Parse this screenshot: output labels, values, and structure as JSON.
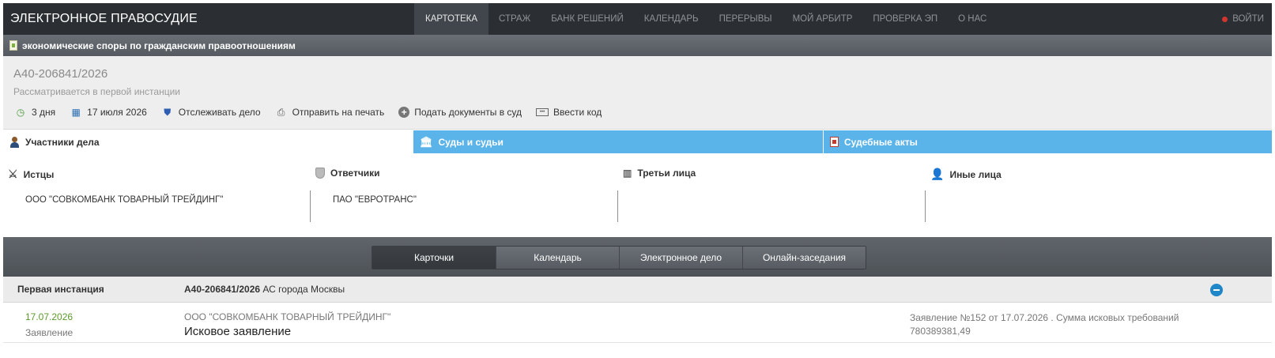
{
  "header": {
    "brand": "ЭЛЕКТРОННОЕ ПРАВОСУДИЕ",
    "nav": [
      "КАРТОТЕКА",
      "СТРАЖ",
      "БАНК РЕШЕНИЙ",
      "КАЛЕНДАРЬ",
      "ПЕРЕРЫВЫ",
      "МОЙ АРБИТР",
      "ПРОВЕРКА ЭП",
      "О НАС"
    ],
    "login": "ВОЙТИ"
  },
  "category": "экономические споры по гражданским правоотношениям",
  "case": {
    "number": "А40-206841/2026",
    "status": "Рассматривается в первой инстанции",
    "actions": {
      "days": "3 дня",
      "date": "17 июля 2026",
      "track": "Отслеживать дело",
      "print": "Отправить на печать",
      "submit": "Подать документы в суд",
      "code": "Ввести код"
    }
  },
  "tabs": [
    "Участники дела",
    "Суды и судьи",
    "Судебные акты"
  ],
  "parties": {
    "plaintiffs": {
      "label": "Истцы",
      "name": "ООО \"СОВКОМБАНК ТОВАРНЫЙ ТРЕЙДИНГ\""
    },
    "defendants": {
      "label": "Ответчики",
      "name": "ПАО \"ЕВРОТРАНС\""
    },
    "third": {
      "label": "Третьи лица",
      "name": ""
    },
    "other": {
      "label": "Иные лица",
      "name": ""
    }
  },
  "subnav": [
    "Карточки",
    "Календарь",
    "Электронное дело",
    "Онлайн-заседания"
  ],
  "instance": {
    "label": "Первая инстанция",
    "case_number": "А40-206841/2026",
    "court": " АС города Москвы"
  },
  "event": {
    "date": "17.07.2026",
    "type": "Заявление",
    "party": "ООО \"СОВКОМБАНК ТОВАРНЫЙ ТРЕЙДИНГ\"",
    "title": "Исковое заявление",
    "note": "Заявление №152 от 17.07.2026 . Сумма исковых требований 780389381,49"
  }
}
